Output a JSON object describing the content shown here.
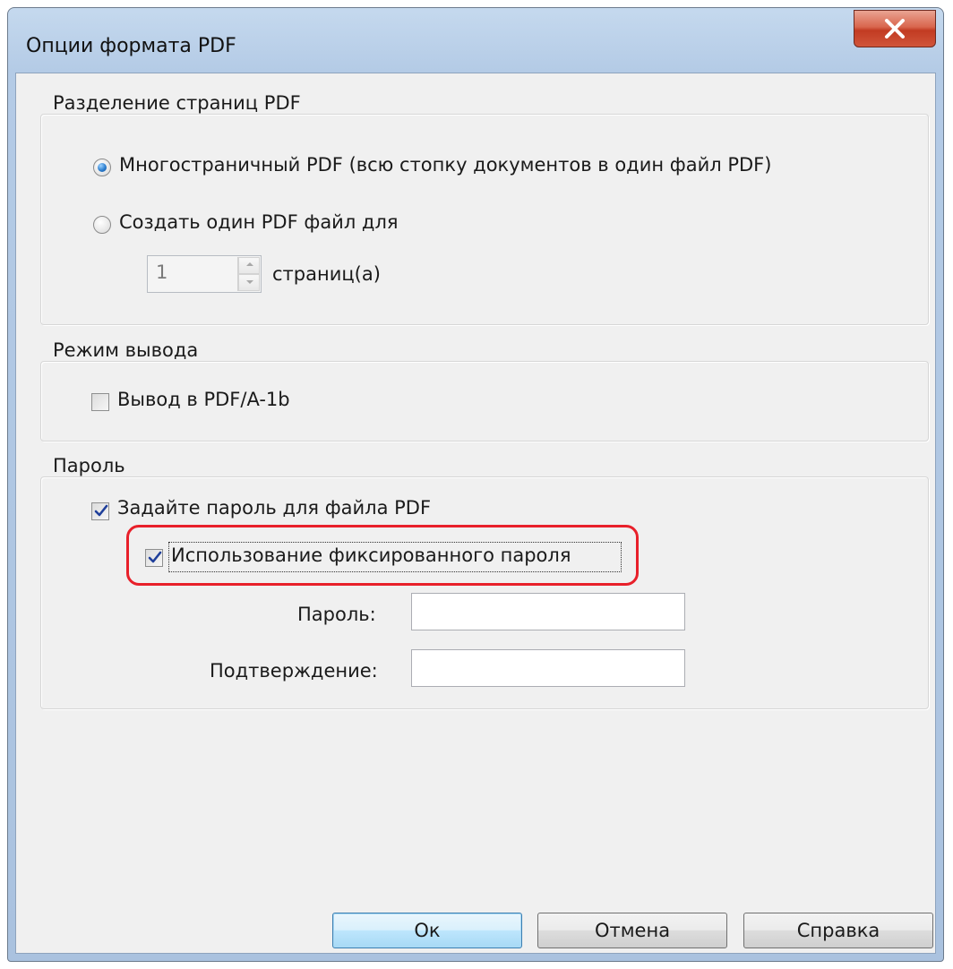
{
  "window": {
    "title": "Опции формата PDF"
  },
  "split_group": {
    "legend": "Разделение страниц PDF",
    "radio_multipage": {
      "label": "Многостраничный PDF (всю стопку документов в один файл PDF)",
      "checked": true
    },
    "radio_single": {
      "label": "Создать один PDF файл для",
      "checked": false
    },
    "pages_value": "1",
    "pages_suffix": "страниц(а)"
  },
  "output_group": {
    "legend": "Режим вывода",
    "pdfa_checkbox": {
      "label": "Вывод в PDF/A-1b",
      "checked": false
    }
  },
  "password_group": {
    "legend": "Пароль",
    "set_password_checkbox": {
      "label": "Задайте пароль для файла PDF",
      "checked": true
    },
    "fixed_password_checkbox": {
      "label": "Использование фиксированного пароля",
      "checked": true
    },
    "password_label": "Пароль:",
    "password_value": "",
    "confirm_label": "Подтверждение:",
    "confirm_value": ""
  },
  "buttons": {
    "ok": "Ок",
    "cancel": "Отмена",
    "help": "Справка"
  },
  "colors": {
    "highlight": "#e8202a",
    "checkmark": "#1f3f9a"
  }
}
